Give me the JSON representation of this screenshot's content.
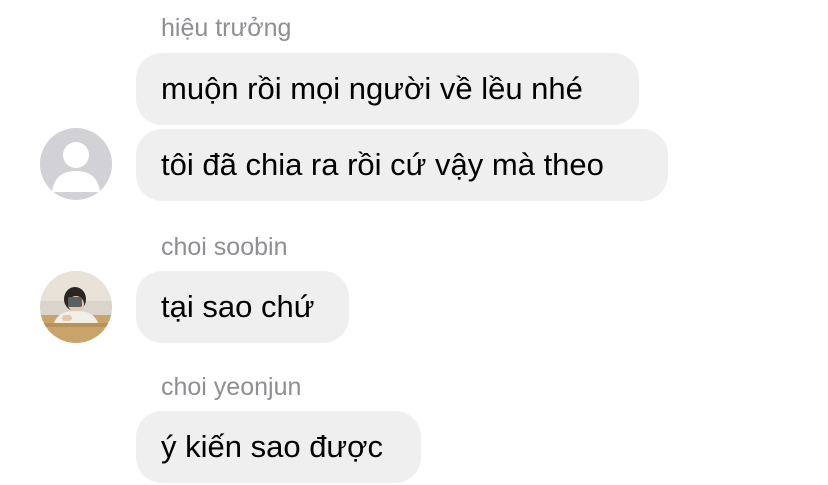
{
  "conversation": {
    "groups": [
      {
        "sender": "hiệu trưởng",
        "avatar_icon": "default-person-icon",
        "messages": [
          "muộn rồi mọi người về lều nhé",
          "tôi đã chia ra rồi cứ vậy mà theo"
        ]
      },
      {
        "sender": "choi soobin",
        "avatar_icon": "profile-photo-icon",
        "messages": [
          "tại sao chứ"
        ]
      },
      {
        "sender": "choi yeonjun",
        "avatar_icon": "none",
        "messages": [
          "ý kiến sao được"
        ]
      }
    ]
  },
  "colors": {
    "bubble_background": "#efefef",
    "sender_text": "#8e8e93",
    "message_text": "#000000",
    "default_avatar_bg": "#d1d1d6",
    "page_background": "#ffffff"
  }
}
